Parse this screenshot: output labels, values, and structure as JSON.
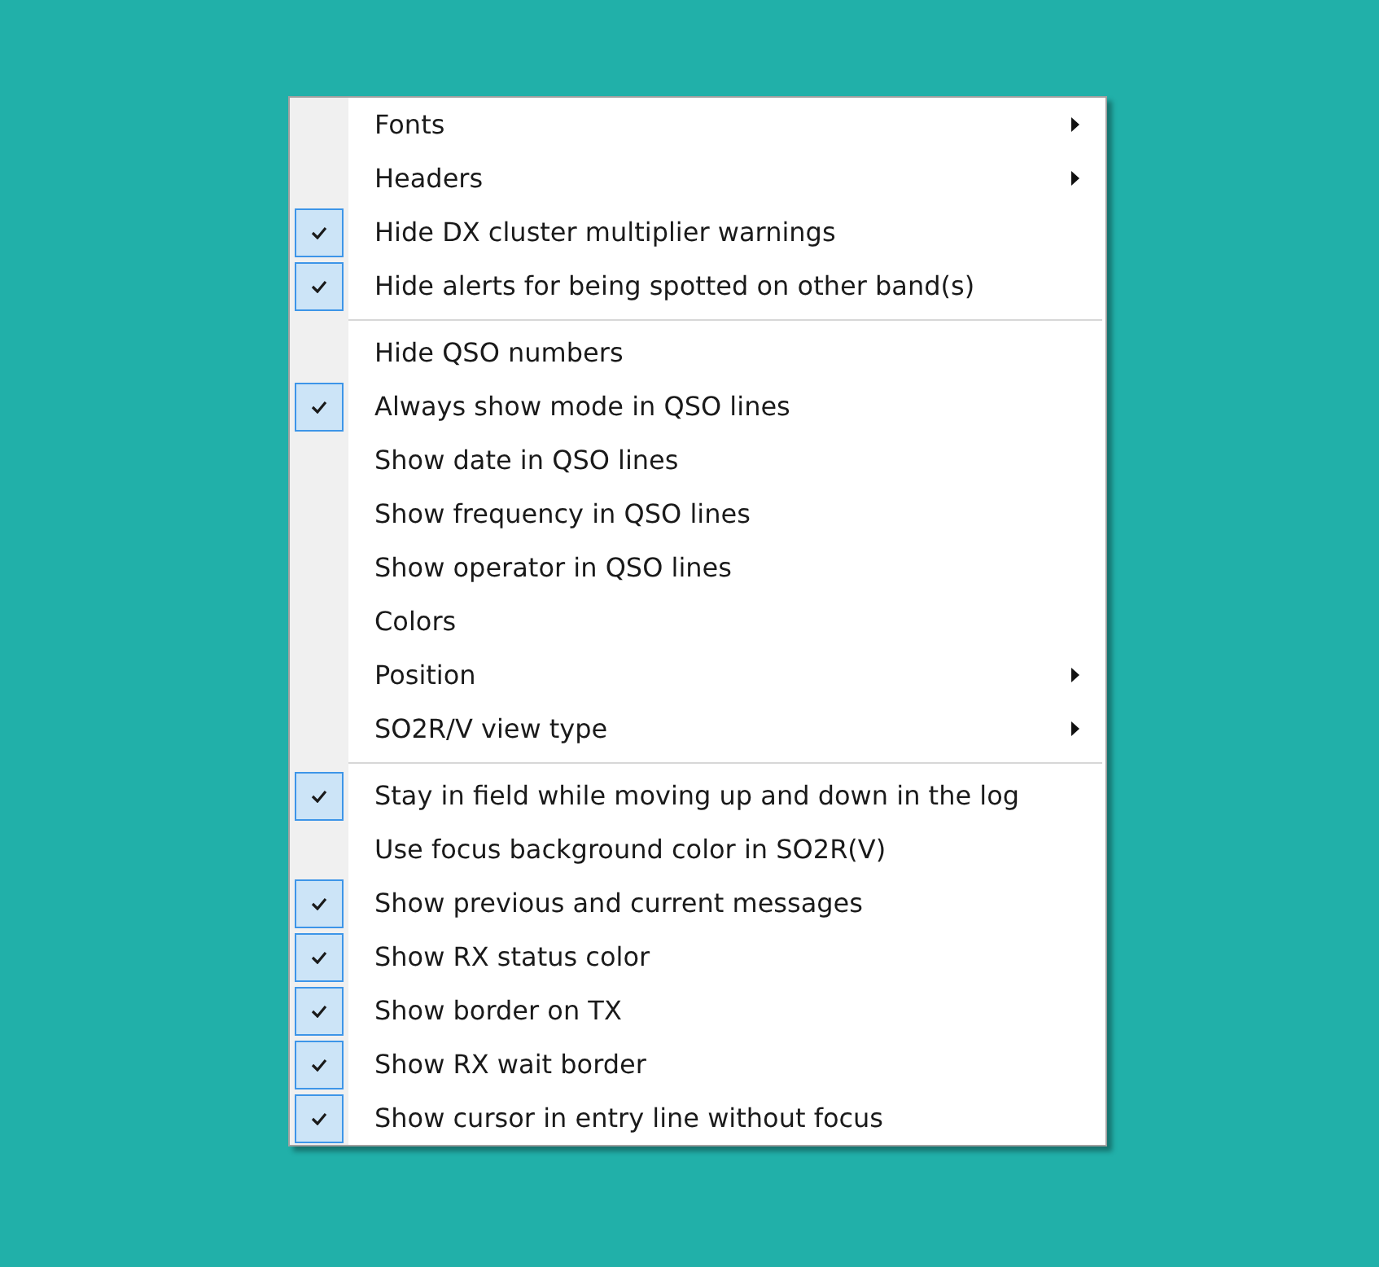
{
  "menu": {
    "groups": [
      {
        "items": [
          {
            "kind": "submenu",
            "label": "Fonts"
          },
          {
            "kind": "submenu",
            "label": "Headers"
          },
          {
            "kind": "toggle",
            "label": "Hide DX cluster multiplier warnings",
            "checked": true
          },
          {
            "kind": "toggle",
            "label": "Hide alerts for being spotted on other band(s)",
            "checked": true
          }
        ]
      },
      {
        "items": [
          {
            "kind": "toggle",
            "label": "Hide QSO numbers",
            "checked": false
          },
          {
            "kind": "toggle",
            "label": "Always show mode in QSO lines",
            "checked": true
          },
          {
            "kind": "toggle",
            "label": "Show date in QSO lines",
            "checked": false
          },
          {
            "kind": "toggle",
            "label": "Show frequency in QSO lines",
            "checked": false
          },
          {
            "kind": "toggle",
            "label": "Show operator in QSO lines",
            "checked": false
          },
          {
            "kind": "toggle",
            "label": "Colors",
            "checked": false
          },
          {
            "kind": "submenu",
            "label": "Position"
          },
          {
            "kind": "submenu",
            "label": "SO2R/V view type"
          }
        ]
      },
      {
        "items": [
          {
            "kind": "toggle",
            "label": "Stay in field while moving up and down in the log",
            "checked": true
          },
          {
            "kind": "toggle",
            "label": "Use focus background color in SO2R(V)",
            "checked": false
          },
          {
            "kind": "toggle",
            "label": "Show previous and current messages",
            "checked": true
          },
          {
            "kind": "toggle",
            "label": "Show RX status color",
            "checked": true
          },
          {
            "kind": "toggle",
            "label": "Show border on TX",
            "checked": true
          },
          {
            "kind": "toggle",
            "label": "Show RX wait border",
            "checked": true
          },
          {
            "kind": "toggle",
            "label": "Show cursor in entry line without focus",
            "checked": true
          }
        ]
      }
    ]
  }
}
